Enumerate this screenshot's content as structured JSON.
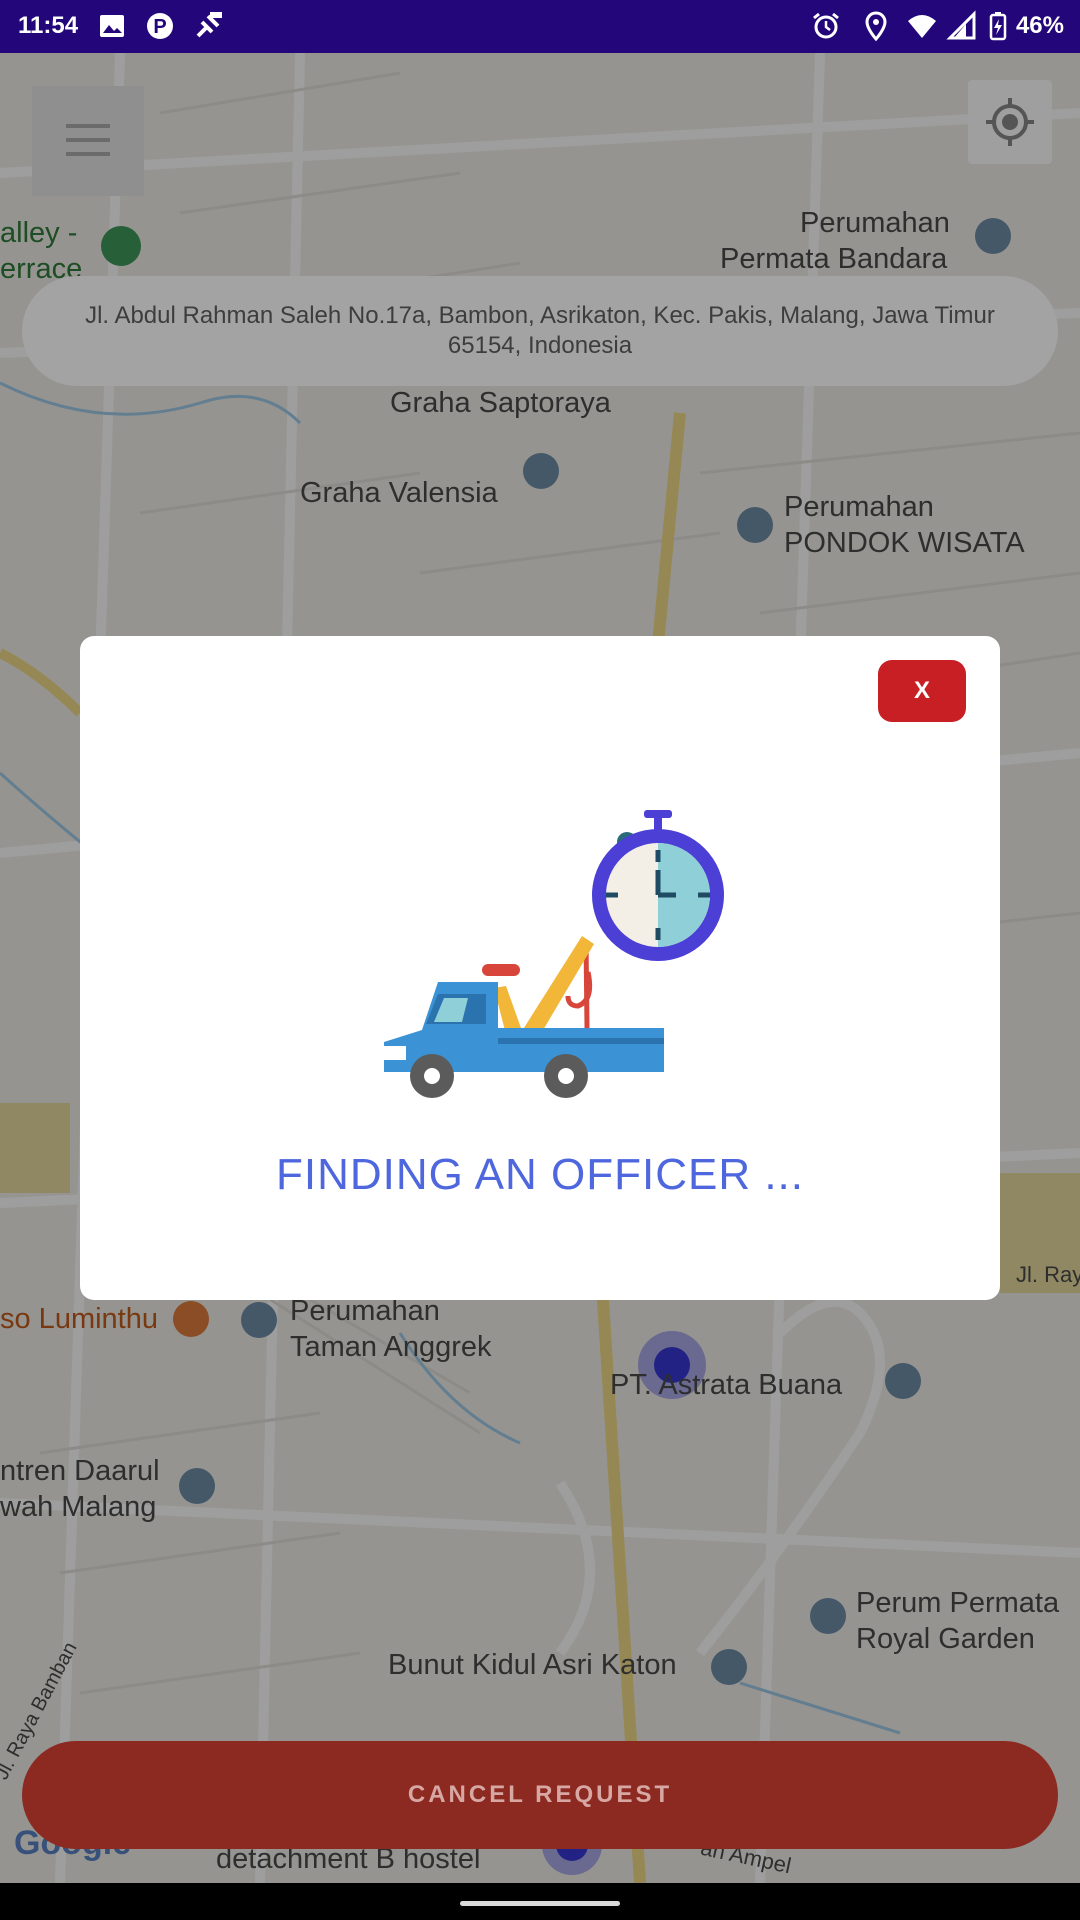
{
  "status_bar": {
    "time": "11:54",
    "battery": "46%",
    "icons": [
      "image-icon",
      "p-app-icon",
      "fake-gps-icon",
      "alarm-icon",
      "location-icon",
      "wifi-icon",
      "signal-icon",
      "battery-icon"
    ]
  },
  "map": {
    "labels": [
      {
        "text": "alley -",
        "color": "green"
      },
      {
        "text": "errace",
        "color": "green"
      },
      {
        "text": "Perumahan",
        "color": "gray"
      },
      {
        "text": "Permata Bandara",
        "color": "gray"
      },
      {
        "text": "Graha Valensia",
        "color": "gray"
      },
      {
        "text": "Perumahan",
        "color": "gray"
      },
      {
        "text": "PONDOK WISATA",
        "color": "gray"
      },
      {
        "text": "Graha Saptoraya",
        "color": "gray"
      },
      {
        "text": "so Luminthu",
        "color": "orange"
      },
      {
        "text": "Perumahan",
        "color": "gray"
      },
      {
        "text": "Taman Anggrek",
        "color": "gray"
      },
      {
        "text": "PT. Astrata Buana",
        "color": "gray"
      },
      {
        "text": "ntren Daarul",
        "color": "gray"
      },
      {
        "text": "wah Malang",
        "color": "gray"
      },
      {
        "text": "Perum Permata",
        "color": "gray"
      },
      {
        "text": "Royal Garden",
        "color": "gray"
      },
      {
        "text": "Bunut Kidul Asri Katon",
        "color": "gray"
      },
      {
        "text": "detachment B hostel",
        "color": "gray"
      },
      {
        "text": "Jl. Ray",
        "color": "gray"
      },
      {
        "text": "Jl. Raya Bamban",
        "color": "gray"
      },
      {
        "text": "an Ampel",
        "color": "gray"
      },
      {
        "text": "Google",
        "color": "gray"
      }
    ]
  },
  "address": "Jl. Abdul Rahman Saleh No.17a, Bambon, Asrikaton, Kec. Pakis, Malang, Jawa Timur 65154, Indonesia",
  "dialog": {
    "close_label": "X",
    "message": "FINDING AN OFFICER ..."
  },
  "cancel_label": "CANCEL REQUEST",
  "colors": {
    "status_bar": "#23067a",
    "close_button": "#c71f24",
    "cancel_button": "#8c2a22",
    "finding_text": "#4e66de"
  }
}
